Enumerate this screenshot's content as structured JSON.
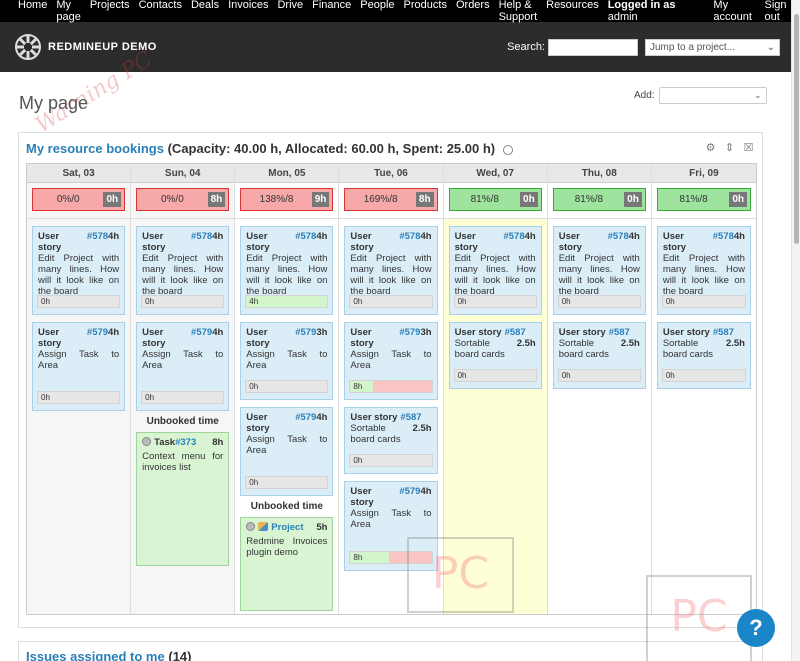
{
  "top_menu": {
    "items": [
      "Home",
      "My page",
      "Projects",
      "Contacts",
      "Deals",
      "Invoices",
      "Drive",
      "Finance",
      "People",
      "Products",
      "Orders",
      "Help & Support",
      "Resources"
    ],
    "logged_in_label": "Logged in as",
    "user": "admin",
    "my_account": "My account",
    "sign_out": "Sign out"
  },
  "header": {
    "title": "REDMINEUP DEMO",
    "search_label": "Search:",
    "search_value": "",
    "jump_placeholder": "Jump to a project..."
  },
  "page": {
    "title": "My page",
    "add_label": "Add:"
  },
  "bookings": {
    "title_link": "My resource bookings",
    "title_rest": " (Capacity: 40.00 h, Allocated: 60.00 h, Spent: 25.00 h)",
    "unbooked_label": "Unbooked time",
    "days": [
      {
        "label": "Sat, 03",
        "pct": "0%/0",
        "hrs": "0h"
      },
      {
        "label": "Sun, 04",
        "pct": "0%/0",
        "hrs": "8h"
      },
      {
        "label": "Mon, 05",
        "pct": "138%/8",
        "hrs": "9h"
      },
      {
        "label": "Tue, 06",
        "pct": "169%/8",
        "hrs": "8h"
      },
      {
        "label": "Wed, 07",
        "pct": "81%/8",
        "hrs": "0h"
      },
      {
        "label": "Thu, 08",
        "pct": "81%/8",
        "hrs": "0h"
      },
      {
        "label": "Fri, 09",
        "pct": "81%/8",
        "hrs": "0h"
      }
    ],
    "cards": {
      "type": "User story",
      "i578": "#578",
      "i579": "#579",
      "i587": "#587",
      "h4": "4h",
      "h3": "3h",
      "h25": "2.5h",
      "desc578": "Edit Project with many lines. How will it look like on the board",
      "desc579": "Assign Task to Area",
      "desc587": "Sortable board cards",
      "b0": "0h",
      "b4": "4h",
      "b8": "8h"
    },
    "task_card": {
      "type": "Task",
      "id": "#373",
      "hours": "8h",
      "desc": "Context menu for invoices list"
    },
    "project_card": {
      "type": "Project",
      "hours": "5h",
      "desc": "Redmine Invoices plugin demo"
    }
  },
  "issues": {
    "title_link": "Issues assigned to me",
    "count": "(14)"
  },
  "help": {
    "label": "?"
  },
  "watermark": {
    "text": "Warning PC",
    "mark": "PC"
  }
}
